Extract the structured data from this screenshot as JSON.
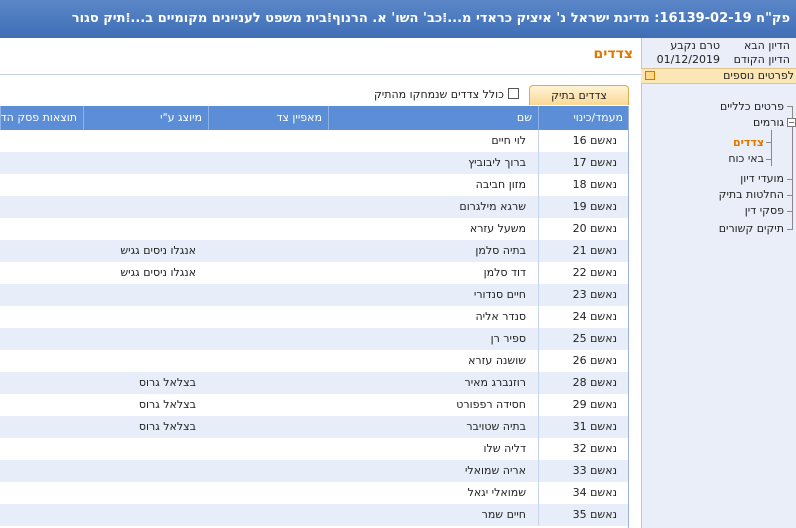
{
  "title": "פק\"ח 16139-02-19: מדינת ישראל נ' איציק כראדי מ...⁞כב' השו' א. הרנוף⁞בית משפט לעניינים מקומיים ב...⁞תיק סגור",
  "side": {
    "next_hearing_label": "הדיון הבא",
    "next_hearing_value": "טרם נקבע",
    "prev_hearing_label": "הדיון הקודם",
    "prev_hearing_value": "01/12/2019",
    "more_details": "לפרטים נוספים",
    "tree": {
      "general": "פרטים כלליים",
      "parties_group": "גורמים",
      "parties": "צדדים",
      "attorneys": "באי כוח",
      "hearings": "מועדי דיון",
      "decisions": "החלטות בתיק",
      "verdicts": "פסקי דין",
      "related_cases": "תיקים קשורים"
    }
  },
  "main": {
    "page_title": "צדדים",
    "tab_label": "צדדים בתיק",
    "include_closed_label": "כולל צדדים שנמחקו מהתיק",
    "columns": {
      "status": "מעמד/כינוי",
      "name": "שם",
      "party_type": "מאפיין צד",
      "represented_by": "מיוצג ע\"י",
      "results": "תוצאות פסק הדין"
    },
    "rows": [
      {
        "status": "נאשם 16",
        "name": "לוי חיים",
        "rep": ""
      },
      {
        "status": "נאשם 17",
        "name": "ברוך ליבוביץ",
        "rep": ""
      },
      {
        "status": "נאשם 18",
        "name": "מזון חביבה",
        "rep": ""
      },
      {
        "status": "נאשם 19",
        "name": "שרגא מילגרום",
        "rep": ""
      },
      {
        "status": "נאשם 20",
        "name": "משעל עזרא",
        "rep": ""
      },
      {
        "status": "נאשם 21",
        "name": "בתיה סלמן",
        "rep": "אנגלו ניסים גגיש"
      },
      {
        "status": "נאשם 22",
        "name": "דוד סלמן",
        "rep": "אנגלו ניסים גגיש"
      },
      {
        "status": "נאשם 23",
        "name": "חיים סנדורי",
        "rep": ""
      },
      {
        "status": "נאשם 24",
        "name": "סנדר אליה",
        "rep": ""
      },
      {
        "status": "נאשם 25",
        "name": "ספיר רן",
        "rep": ""
      },
      {
        "status": "נאשם 26",
        "name": "שושנה עזרא",
        "rep": ""
      },
      {
        "status": "נאשם 28",
        "name": "רוזנברג מאיר",
        "rep": "בצלאל גרוס"
      },
      {
        "status": "נאשם 29",
        "name": "חסידה רפפורט",
        "rep": "בצלאל גרוס"
      },
      {
        "status": "נאשם 31",
        "name": "בתיה שטויבר",
        "rep": "בצלאל גרוס"
      },
      {
        "status": "נאשם 32",
        "name": "דליה שלו",
        "rep": ""
      },
      {
        "status": "נאשם 33",
        "name": "אריה שמואלי",
        "rep": ""
      },
      {
        "status": "נאשם 34",
        "name": "שמואלי יגאל",
        "rep": ""
      },
      {
        "status": "נאשם 35",
        "name": "חיים שמר",
        "rep": ""
      }
    ]
  }
}
